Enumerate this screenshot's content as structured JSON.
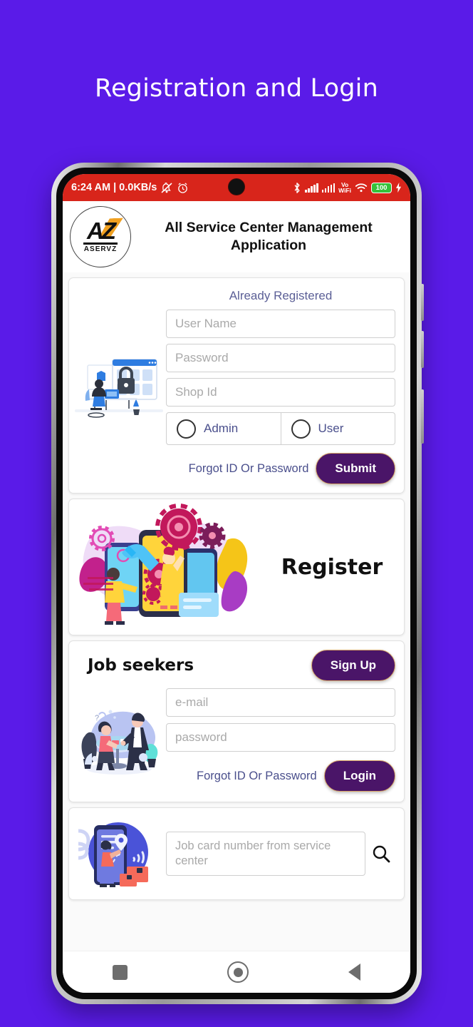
{
  "page": {
    "title": "Registration and Login",
    "background_color": "#5a1be8"
  },
  "status_bar": {
    "time_and_network": "6:24 AM | 0.0KB/s",
    "mute_icon": "mute-bell-icon",
    "alarm_icon": "alarm-clock-icon",
    "bluetooth_icon": "bluetooth-icon",
    "signal_icon": "signal-bars-icon",
    "volte_label": "Vo",
    "wifi_calling_label": "WiFi",
    "wifi_icon": "wifi-icon",
    "battery_level": "100",
    "charging_icon": "charging-bolt-icon",
    "background_color": "#d8251b"
  },
  "app_header": {
    "logo_text": "AZ",
    "logo_name": "ASERVZ",
    "title": "All Service Center Management Application"
  },
  "login_card": {
    "heading": "Already Registered",
    "illustration": "security-login-illustration",
    "username_placeholder": "User Name",
    "password_placeholder": "Password",
    "shop_id_placeholder": "Shop Id",
    "radio_admin_label": "Admin",
    "radio_user_label": "User",
    "forgot_link": "Forgot ID Or Password",
    "submit_label": "Submit"
  },
  "register_card": {
    "illustration": "register-gears-phones-illustration",
    "label": "Register"
  },
  "job_seekers_card": {
    "heading": "Job seekers",
    "signup_label": "Sign Up",
    "illustration": "job-interview-illustration",
    "email_placeholder": "e-mail",
    "password_placeholder": "password",
    "forgot_link": "Forgot ID Or Password",
    "login_label": "Login"
  },
  "job_card_search": {
    "illustration": "delivery-tracking-illustration",
    "placeholder": "Job card number from service center",
    "search_icon": "search-icon"
  },
  "nav_bar": {
    "recents_icon": "square-recents-icon",
    "home_icon": "circle-home-icon",
    "back_icon": "triangle-back-icon"
  },
  "colors": {
    "accent_purple": "#4a1568",
    "button_border": "#d8a566",
    "status_red": "#d8251b",
    "link_color": "#4a4f8c"
  }
}
